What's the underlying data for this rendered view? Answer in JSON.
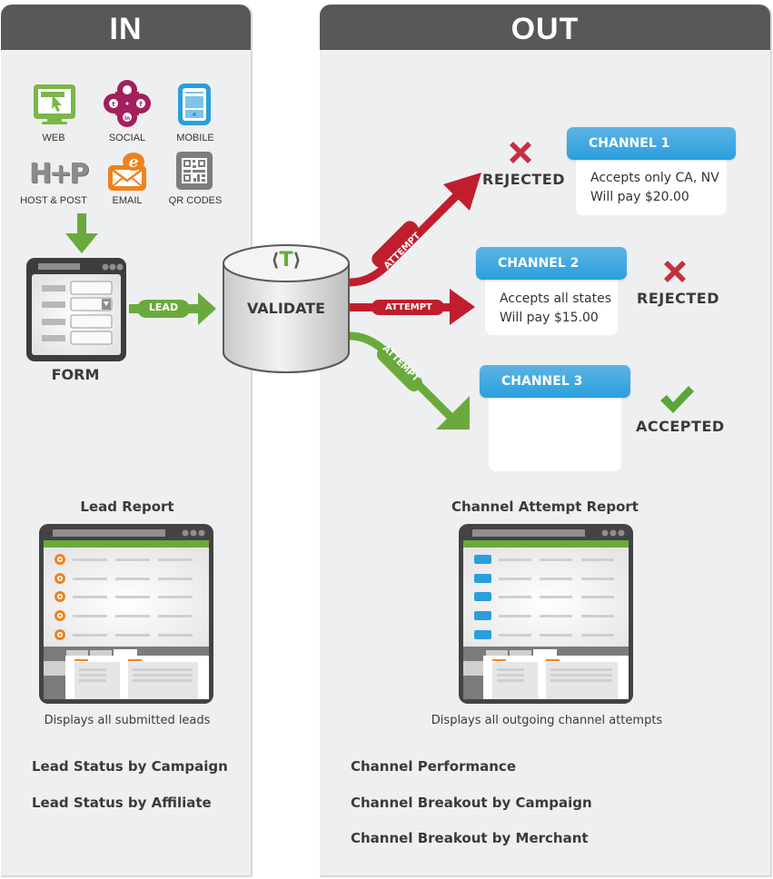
{
  "in_panel": {
    "title": "IN",
    "sources": [
      {
        "label": "WEB",
        "icon": "web-monitor-icon",
        "color": "#7ab648"
      },
      {
        "label": "SOCIAL",
        "icon": "social-icon",
        "color": "#a31f5e"
      },
      {
        "label": "MOBILE",
        "icon": "mobile-icon",
        "color": "#2a9fdc"
      },
      {
        "label": "HOST & POST",
        "icon": "host-post-icon",
        "color": "#8c8c8c"
      },
      {
        "label": "EMAIL",
        "icon": "email-icon",
        "color": "#f0821e"
      },
      {
        "label": "QR CODES",
        "icon": "qr-code-icon",
        "color": "#7d7d7d"
      }
    ],
    "form_label": "FORM",
    "lead_arrow_label": "LEAD",
    "report": {
      "title": "Lead Report",
      "description": "Displays all submitted leads"
    },
    "links": [
      "Lead Status by Campaign",
      "Lead Status by Affiliate"
    ]
  },
  "validate": {
    "label": "VALIDATE",
    "logo": "T"
  },
  "out_panel": {
    "title": "OUT",
    "attempt_label": "ATTEMPT",
    "channels": [
      {
        "name": "CHANNEL 1",
        "lines": [
          "Accepts only CA, NV",
          "Will pay $20.00"
        ],
        "status": "REJECTED"
      },
      {
        "name": "CHANNEL 2",
        "lines": [
          "Accepts all states",
          "Will pay $15.00"
        ],
        "status": "REJECTED"
      },
      {
        "name": "CHANNEL 3",
        "lines": [],
        "status": "ACCEPTED"
      }
    ],
    "report": {
      "title": "Channel Attempt Report",
      "description": "Displays all outgoing channel attempts"
    },
    "links": [
      "Channel Performance",
      "Channel Breakout by Campaign",
      "Channel Breakout by Merchant"
    ]
  },
  "colors": {
    "header": "#58585a",
    "panel_bg": "#eeeff1",
    "green": "#6aaa3c",
    "red": "#c01e2d",
    "blue": "#2a9fdc",
    "orange": "#f0821e"
  }
}
